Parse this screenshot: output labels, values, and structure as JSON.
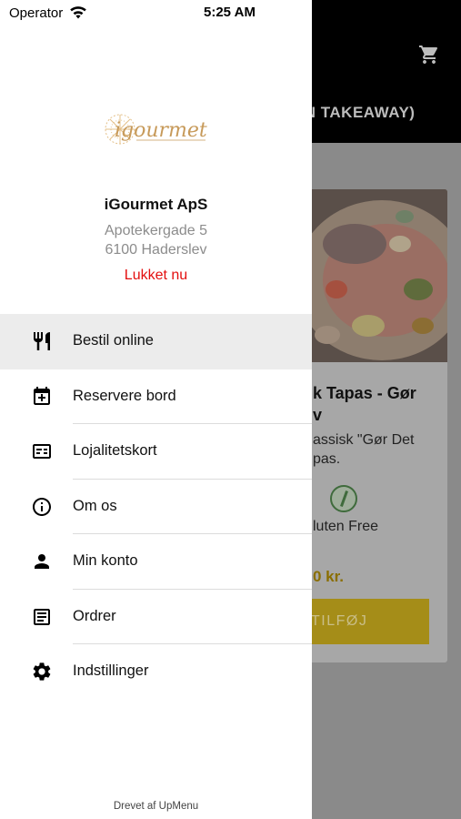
{
  "status_bar": {
    "carrier": "Operator",
    "time": "5:25 AM"
  },
  "background": {
    "header_title": "UN TAKEAWAY)",
    "card": {
      "title_line1": "k Tapas - Gør",
      "title_line2": "v",
      "desc_line1": "assisk \"Gør Det",
      "desc_line2": "pas.",
      "gluten_label": "luten Free",
      "price": "0 kr.",
      "add_button": "TILFØJ"
    }
  },
  "drawer": {
    "logo_text": "igourmet",
    "shop_name": "iGourmet ApS",
    "address_line1": "Apotekergade 5",
    "address_line2": "6100 Haderslev",
    "open_status": "Lukket nu",
    "menu": [
      {
        "label": "Bestil online",
        "icon": "fork-knife-icon"
      },
      {
        "label": "Reservere bord",
        "icon": "calendar-plus-icon"
      },
      {
        "label": "Lojalitetskort",
        "icon": "loyalty-card-icon"
      },
      {
        "label": "Om os",
        "icon": "info-icon"
      },
      {
        "label": "Min konto",
        "icon": "person-icon"
      },
      {
        "label": "Ordrer",
        "icon": "receipt-icon"
      },
      {
        "label": "Indstillinger",
        "icon": "gear-icon"
      }
    ],
    "footer": "Drevet af UpMenu"
  },
  "colors": {
    "closed_red": "#e30e0e",
    "active_row": "#ececec",
    "price_gold": "#d4b200"
  }
}
